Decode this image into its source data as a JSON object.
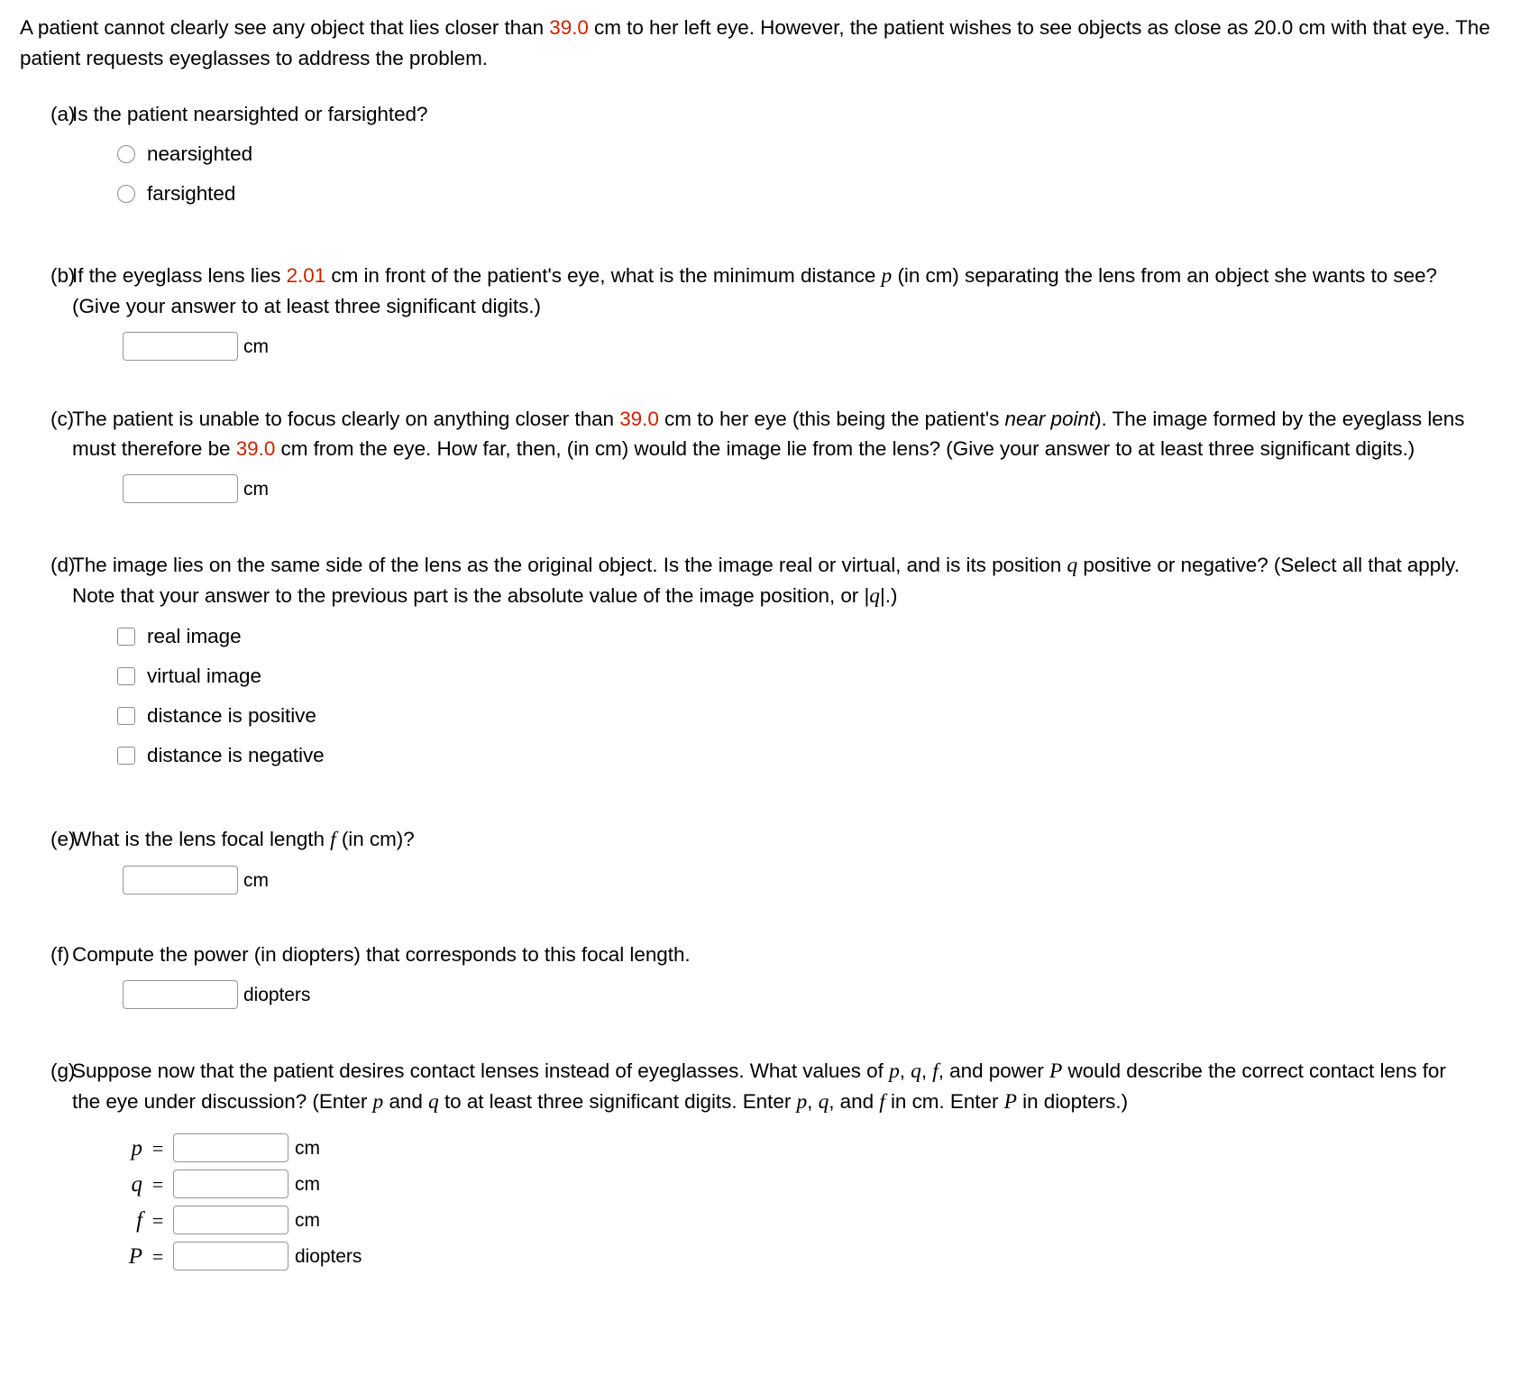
{
  "problem": {
    "intro_1": "A patient cannot clearly see any object that lies closer than ",
    "intro_near_point": "39.0",
    "intro_2": " cm to her left eye. However, the patient wishes to see objects as close as 20.0 cm with that eye. The patient requests eyeglasses to address the problem."
  },
  "parts": {
    "a": {
      "label": "(a)",
      "question": "Is the patient nearsighted or farsighted?",
      "options": [
        {
          "label": "nearsighted",
          "type": "radio",
          "checked": false
        },
        {
          "label": "farsighted",
          "type": "radio",
          "checked": false
        }
      ]
    },
    "b": {
      "label": "(b)",
      "text_1": "If the eyeglass lens lies ",
      "value": "2.01",
      "text_2": " cm in front of the patient's eye, what is the minimum distance ",
      "var": "p",
      "text_3": " (in cm) separating the lens from an object she wants to see? (Give your answer to at least three significant digits.)",
      "answer_value": "",
      "unit": "cm"
    },
    "c": {
      "label": "(c)",
      "text_1": "The patient is unable to focus clearly on anything closer than ",
      "value_1": "39.0",
      "text_2": " cm to her eye (this being the patient's ",
      "italic_term": "near point",
      "text_3": "). The image formed by the eyeglass lens must therefore be ",
      "value_2": "39.0",
      "text_4": " cm from the eye. How far, then, (in cm) would the image lie from the lens? (Give your answer to at least three significant digits.)",
      "answer_value": "",
      "unit": "cm"
    },
    "d": {
      "label": "(d)",
      "text_1": "The image lies on the same side of the lens as the original object. Is the image real or virtual, and is its position ",
      "var_1": "q",
      "text_2": " positive or negative? (Select all that apply. Note that your answer to the previous part is the absolute value of the image position, or |",
      "var_2": "q",
      "text_3": "|.)",
      "options": [
        {
          "label": "real image",
          "type": "checkbox",
          "checked": false
        },
        {
          "label": "virtual image",
          "type": "checkbox",
          "checked": false
        },
        {
          "label": "distance is positive",
          "type": "checkbox",
          "checked": false
        },
        {
          "label": "distance is negative",
          "type": "checkbox",
          "checked": false
        }
      ]
    },
    "e": {
      "label": "(e)",
      "text_1": "What is the lens focal length ",
      "var": "f",
      "text_2": " (in cm)?",
      "answer_value": "",
      "unit": "cm"
    },
    "f": {
      "label": "(f)",
      "text": "Compute the power (in diopters) that corresponds to this focal length.",
      "answer_value": "",
      "unit": "diopters"
    },
    "g": {
      "label": "(g)",
      "text_1": "Suppose now that the patient desires contact lenses instead of eyeglasses. What values of ",
      "var_p1": "p",
      "sep_1": ", ",
      "var_q1": "q",
      "sep_2": ", ",
      "var_f1": "f",
      "text_2": ", and power ",
      "var_P1": "P",
      "text_3": " would describe the correct contact lens for the eye under discussion? (Enter ",
      "var_p2": "p",
      "text_4": " and ",
      "var_q2": "q",
      "text_5": " to at least three significant digits. Enter ",
      "var_p3": "p",
      "sep_3": ", ",
      "var_q3": "q",
      "text_6": ", and ",
      "var_f2": "f",
      "text_7": " in cm. Enter ",
      "var_P2": "P",
      "text_8": " in diopters.)",
      "fields": [
        {
          "name": "p",
          "eq": "=",
          "value": "",
          "unit": "cm"
        },
        {
          "name": "q",
          "eq": "=",
          "value": "",
          "unit": "cm"
        },
        {
          "name": "f",
          "eq": "=",
          "value": "",
          "unit": "cm"
        },
        {
          "name": "P",
          "eq": "=",
          "value": "",
          "unit": "diopters"
        }
      ]
    }
  },
  "colors": {
    "highlight": "#cc2200",
    "text": "#000000",
    "input_border": "#959595",
    "control_border": "#8c8c8c"
  }
}
